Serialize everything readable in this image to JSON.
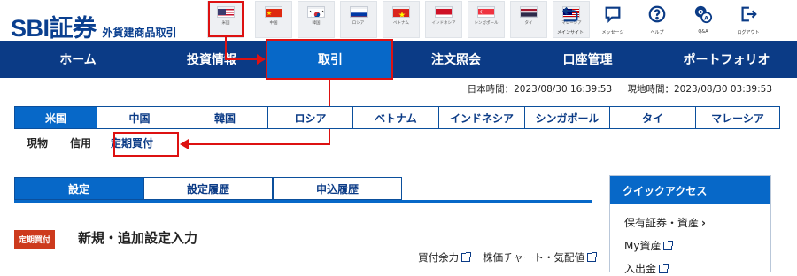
{
  "brand": {
    "name": "SBI証券",
    "subtitle": "外貨建商品取引"
  },
  "flags": [
    {
      "id": "us",
      "label": "米国"
    },
    {
      "id": "cn",
      "label": "中国"
    },
    {
      "id": "kr",
      "label": "韓国"
    },
    {
      "id": "ru",
      "label": "ロシア"
    },
    {
      "id": "vn",
      "label": "ベトナム"
    },
    {
      "id": "id",
      "label": "インドネシア"
    },
    {
      "id": "sg",
      "label": "シンガポール"
    },
    {
      "id": "th",
      "label": "タイ"
    },
    {
      "id": "my",
      "label": "マレーシア"
    }
  ],
  "utility": [
    {
      "label": "メインサイト",
      "icon": "back-arrow-icon"
    },
    {
      "label": "メッセージ",
      "icon": "chat-icon"
    },
    {
      "label": "ヘルプ",
      "icon": "help-icon"
    },
    {
      "label": "Q&A",
      "icon": "qa-icon"
    },
    {
      "label": "ログアウト",
      "icon": "logout-icon"
    }
  ],
  "mainnav": [
    {
      "label": "ホーム"
    },
    {
      "label": "投資情報"
    },
    {
      "label": "取引",
      "active": true
    },
    {
      "label": "注文照会"
    },
    {
      "label": "口座管理"
    },
    {
      "label": "ポートフォリオ"
    }
  ],
  "time": {
    "japan": "日本時間：2023/08/30 16:39:53",
    "local": "現地時間：2023/08/30 03:39:53"
  },
  "country_tabs": [
    {
      "label": "米国",
      "active": true
    },
    {
      "label": "中国"
    },
    {
      "label": "韓国"
    },
    {
      "label": "ロシア"
    },
    {
      "label": "ベトナム"
    },
    {
      "label": "インドネシア"
    },
    {
      "label": "シンガポール"
    },
    {
      "label": "タイ"
    },
    {
      "label": "マレーシア"
    }
  ],
  "sub_tabs": [
    {
      "label": "現物"
    },
    {
      "label": "信用"
    },
    {
      "label": "定期買付",
      "active": true
    }
  ],
  "section_tabs": [
    {
      "label": "設定",
      "active": true
    },
    {
      "label": "設定履歴"
    },
    {
      "label": "申込履歴"
    }
  ],
  "badge": "定期買付",
  "heading": "新規・追加設定入力",
  "links": [
    {
      "label": "買付余力"
    },
    {
      "label": "株価チャート・気配値"
    }
  ],
  "quick_access": {
    "title": "クイックアクセス",
    "items": [
      {
        "label": "保有証券・資産",
        "suffix": "chevron"
      },
      {
        "label": "My資産",
        "suffix": "external"
      },
      {
        "label": "入出金",
        "suffix": "external"
      }
    ]
  },
  "colors": {
    "navy": "#0b3b86",
    "blue": "#0768c8",
    "highlight": "#dd1111",
    "badge": "#cd3a1d"
  }
}
